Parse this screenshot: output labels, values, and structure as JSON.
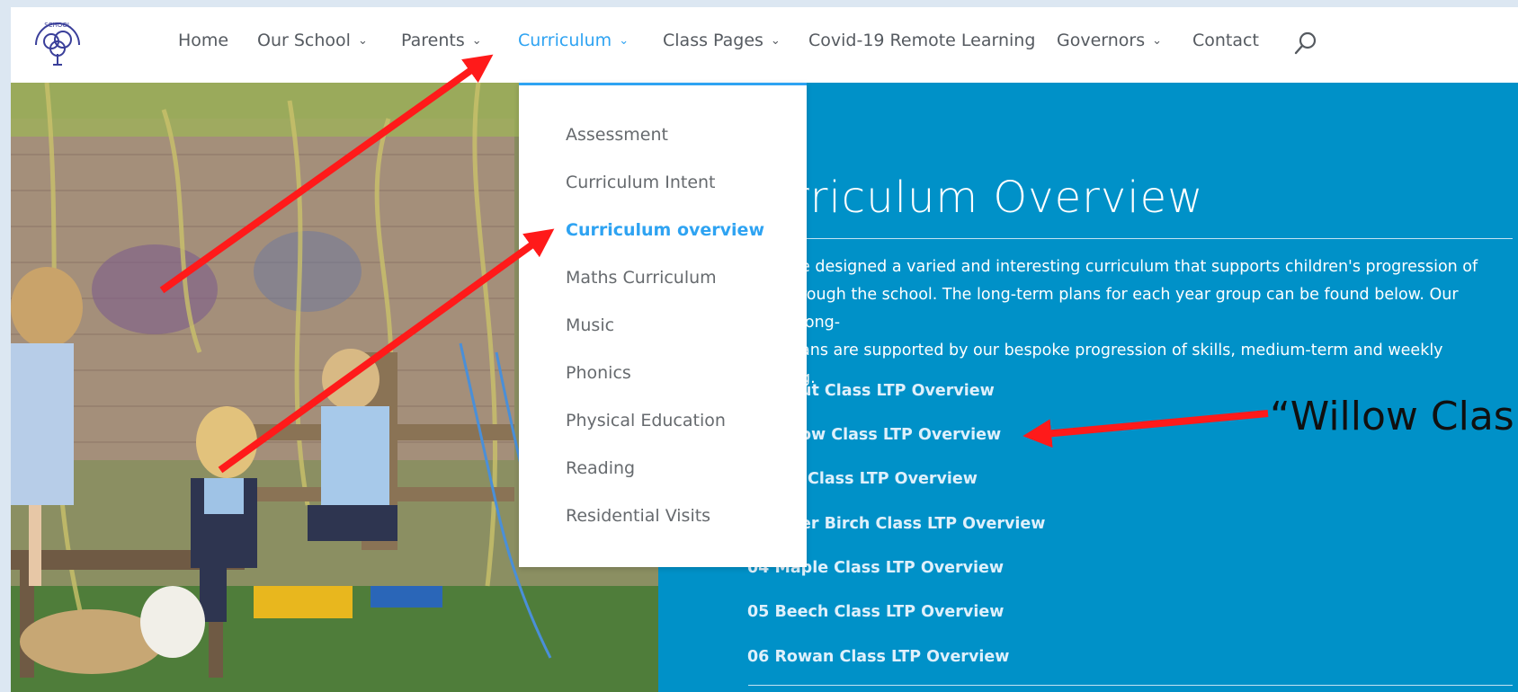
{
  "site": {
    "logo_text": "SCHOOL"
  },
  "nav": {
    "items": [
      {
        "label": "Home",
        "has_dropdown": false
      },
      {
        "label": "Our School",
        "has_dropdown": true
      },
      {
        "label": "Parents",
        "has_dropdown": true
      },
      {
        "label": "Curriculum",
        "has_dropdown": true,
        "active": true
      },
      {
        "label": "Class Pages",
        "has_dropdown": true
      },
      {
        "label": "Covid-19 Remote Learning",
        "has_dropdown": false
      },
      {
        "label": "Governors",
        "has_dropdown": true
      },
      {
        "label": "Contact",
        "has_dropdown": false
      }
    ],
    "chevron_glyph": "⌄",
    "search_icon": "search-icon"
  },
  "dropdown": {
    "items": [
      {
        "label": "Assessment"
      },
      {
        "label": "Curriculum Intent"
      },
      {
        "label": "Curriculum overview",
        "active": true
      },
      {
        "label": "Maths Curriculum"
      },
      {
        "label": "Music"
      },
      {
        "label": "Phonics"
      },
      {
        "label": "Physical Education"
      },
      {
        "label": "Reading"
      },
      {
        "label": "Residential Visits"
      }
    ]
  },
  "panel": {
    "title": "rriculum Overview",
    "intro_lines": [
      "e designed a varied and interesting curriculum that supports children's progression of",
      "rough the school. The long-term plans for each year group can be found below. Our long-",
      "ans are supported by our bespoke progression of skills, medium-term and weekly",
      "g."
    ],
    "links": [
      "ut Class LTP Overview",
      "ow Class LTP Overview",
      "Class LTP Overview",
      "er Birch Class LTP Overview",
      "04 Maple Class LTP Overview",
      "05 Beech Class LTP Overview",
      "06 Rowan Class LTP Overview"
    ]
  },
  "annotation": {
    "callout_text": "“Willow Clas",
    "arrow_color": "#ff1a1a"
  },
  "colors": {
    "accent": "#2ea3f2",
    "panel_blue": "#0091c8",
    "frame": "#dce7f2"
  }
}
